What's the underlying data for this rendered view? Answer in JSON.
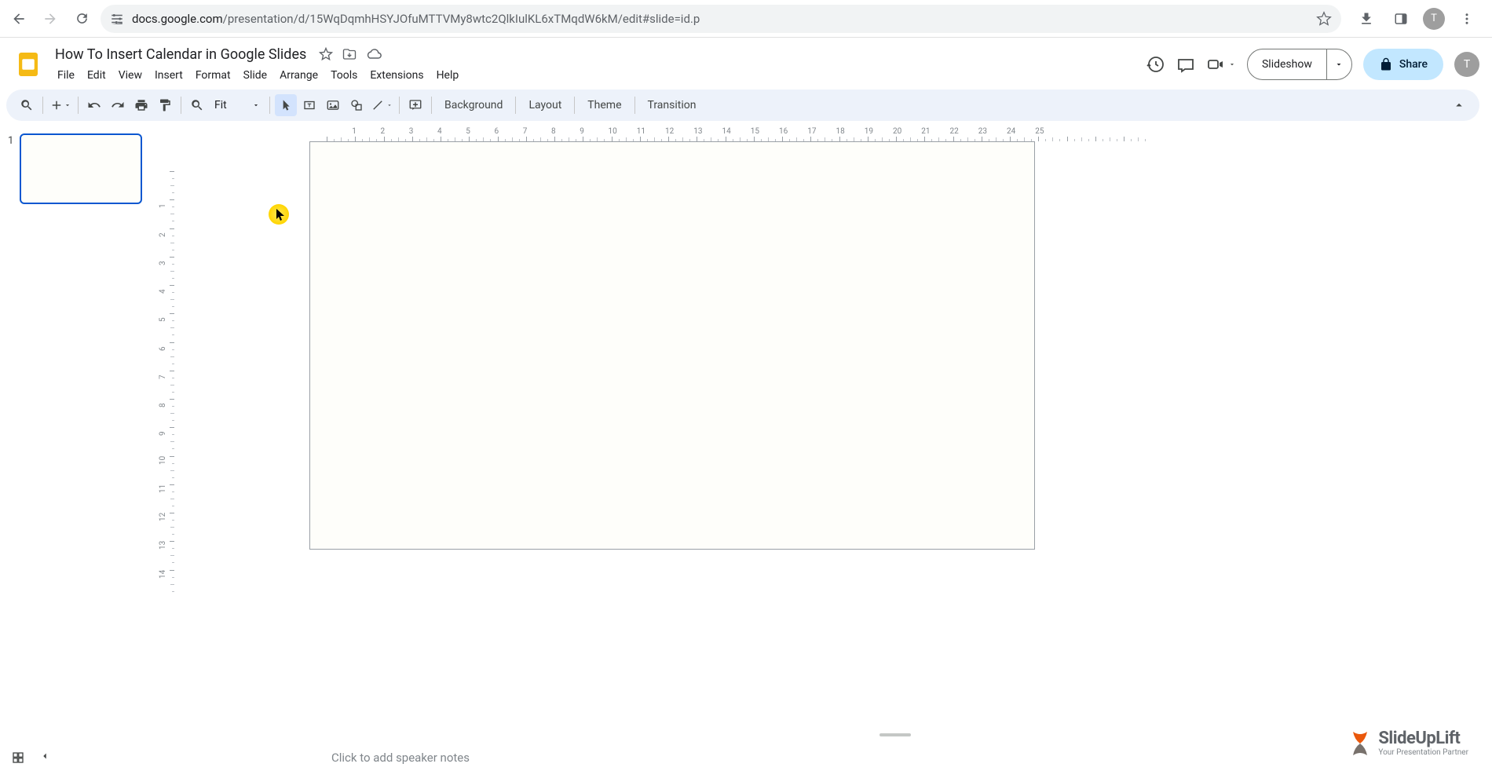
{
  "browser": {
    "url_domain": "docs.google.com",
    "url_path": "/presentation/d/15WqDqmhHSYJOfuMTTVMy8wtc2QlkIulKL6xTMqdW6kM/edit#slide=id.p",
    "avatar_letter": "T"
  },
  "header": {
    "doc_title": "How To Insert Calendar in Google Slides",
    "slideshow_label": "Slideshow",
    "share_label": "Share",
    "avatar_letter": "T"
  },
  "menubar": {
    "items": [
      "File",
      "Edit",
      "View",
      "Insert",
      "Format",
      "Slide",
      "Arrange",
      "Tools",
      "Extensions",
      "Help"
    ]
  },
  "toolbar": {
    "zoom_label": "Fit",
    "background_label": "Background",
    "layout_label": "Layout",
    "theme_label": "Theme",
    "transition_label": "Transition"
  },
  "ruler": {
    "h_values": [
      1,
      2,
      3,
      4,
      5,
      6,
      7,
      8,
      9,
      10,
      11,
      12,
      13,
      14,
      15,
      16,
      17,
      18,
      19,
      20,
      21,
      22,
      23,
      24,
      25
    ],
    "v_values": [
      1,
      2,
      3,
      4,
      5,
      6,
      7,
      8,
      9,
      10,
      11,
      12,
      13,
      14
    ]
  },
  "slides": {
    "current_number": "1"
  },
  "speaker_notes": {
    "placeholder": "Click to add speaker notes"
  },
  "watermark": {
    "name": "SlideUpLift",
    "tagline": "Your Presentation Partner"
  }
}
